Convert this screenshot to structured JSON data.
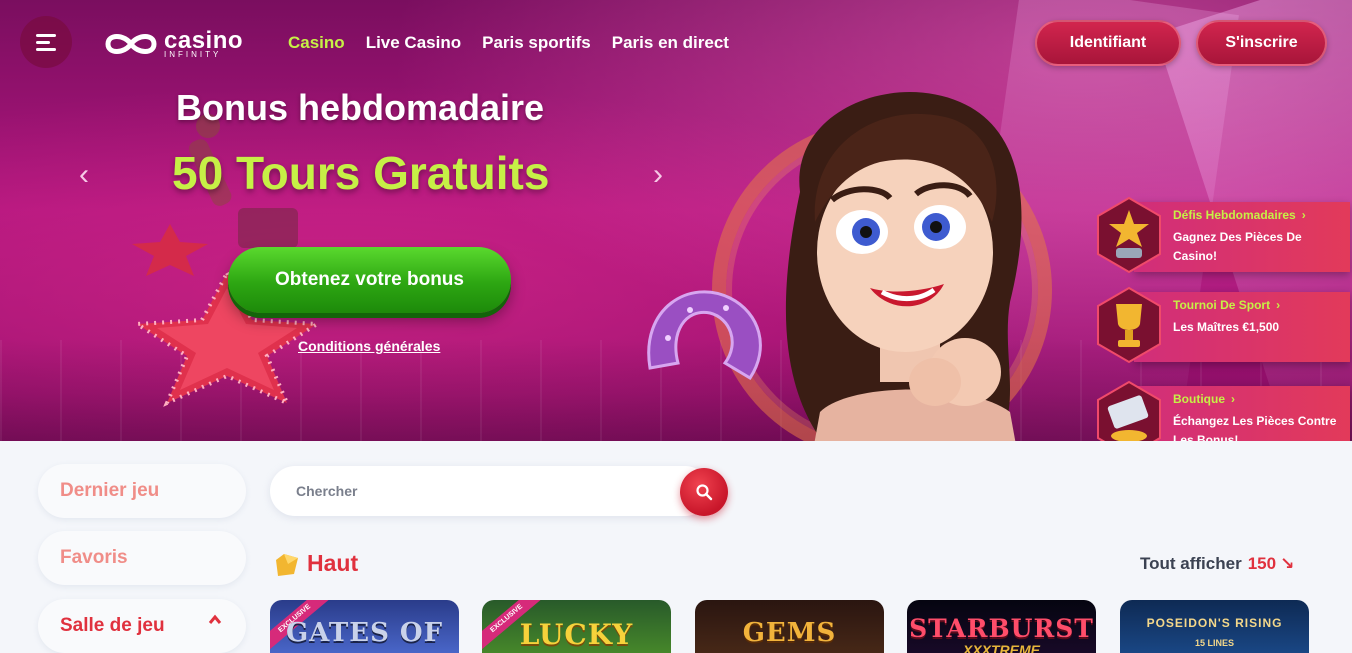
{
  "header": {
    "logo_text": "casino",
    "logo_subtext": "INFINITY",
    "nav": [
      "Casino",
      "Live Casino",
      "Paris sportifs",
      "Paris en direct"
    ],
    "login_label": "Identifiant",
    "signup_label": "S'inscrire"
  },
  "promo": {
    "title": "Bonus hebdomadaire",
    "subtitle": "50 Tours Gratuits",
    "cta_label": "Obtenez votre bonus",
    "terms_label": "Conditions générales",
    "prev_arrow": "‹",
    "next_arrow": "›"
  },
  "widgets": [
    {
      "title": "Défis Hebdomadaires",
      "text": "Gagnez Des Pièces De Casino!",
      "icon": "star-trophy-icon"
    },
    {
      "title": "Tournoi De Sport",
      "text": "Les Maîtres €1,500",
      "icon": "cup-trophy-icon"
    },
    {
      "title": "Boutique",
      "text": "Échangez Les Pièces Contre Les Bonus!",
      "icon": "card-coins-icon"
    }
  ],
  "sidebar": {
    "items": [
      "Dernier jeu",
      "Favoris",
      "Salle de jeu"
    ]
  },
  "search": {
    "placeholder": "Chercher"
  },
  "section": {
    "title": "Haut",
    "see_all_label": "Tout afficher",
    "count": "150",
    "arrow": "↘"
  },
  "games": [
    {
      "name": "GATES OF",
      "badge": "EXCLUSIVE"
    },
    {
      "name": "LUCKY",
      "badge": "EXCLUSIVE"
    },
    {
      "name": "GEMS",
      "badge": ""
    },
    {
      "name": "STARBURST",
      "sub": "XXXTREME"
    },
    {
      "name": "POSEIDON'S RISING",
      "sub": "15 LINES"
    }
  ],
  "colors": {
    "accent_green": "#c6f046",
    "brand_red": "#e0313e",
    "hero_magenta": "#b0157e"
  }
}
